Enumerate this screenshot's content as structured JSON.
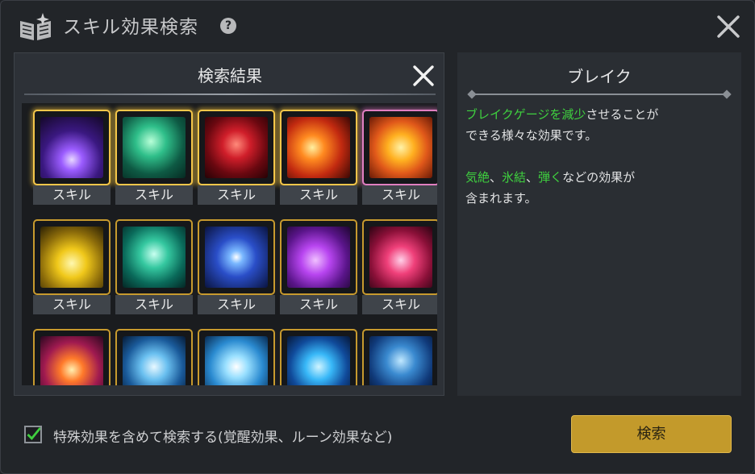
{
  "header": {
    "title": "スキル効果検索",
    "help": "?"
  },
  "results": {
    "title": "検索結果",
    "rows": [
      [
        {
          "label": "スキル",
          "art": "purple-lightning",
          "state": "selected"
        },
        {
          "label": "スキル",
          "art": "green-claw",
          "state": "selected"
        },
        {
          "label": "スキル",
          "art": "red-rune",
          "state": "selected"
        },
        {
          "label": "スキル",
          "art": "fire-meteor",
          "state": "selected"
        },
        {
          "label": "スキル",
          "art": "lava-burst",
          "state": "pink"
        }
      ],
      [
        {
          "label": "スキル",
          "art": "yellow-lightning",
          "state": "normal"
        },
        {
          "label": "スキル",
          "art": "green-storm",
          "state": "normal"
        },
        {
          "label": "スキル",
          "art": "blue-star",
          "state": "normal"
        },
        {
          "label": "スキル",
          "art": "purple-vortex",
          "state": "normal"
        },
        {
          "label": "スキル",
          "art": "pink-vortex",
          "state": "normal"
        }
      ],
      [
        {
          "label": "",
          "art": "orange-flare",
          "state": "normal"
        },
        {
          "label": "",
          "art": "ice-slash",
          "state": "normal"
        },
        {
          "label": "",
          "art": "frost-orb",
          "state": "normal"
        },
        {
          "label": "",
          "art": "blue-ring",
          "state": "normal"
        },
        {
          "label": "",
          "art": "ice-spikes",
          "state": "normal"
        }
      ]
    ]
  },
  "description": {
    "title": "ブレイク",
    "p1_hl": "ブレイクゲージを減少",
    "p1_rest": "させることが",
    "p1_line2": "できる様々な効果です。",
    "p2_hl1": "気絶",
    "p2_sep1": "、",
    "p2_hl2": "氷結",
    "p2_sep2": "、",
    "p2_hl3": "弾く",
    "p2_rest": "などの効果が",
    "p2_line2": "含まれます。"
  },
  "footer": {
    "checkbox_checked": true,
    "checkbox_label": "特殊効果を含めて検索する(覚醒効果、ルーン効果など)",
    "search_label": "検索"
  },
  "colors": {
    "accent_gold": "#c39a2b",
    "highlight_green": "#3fd13f",
    "panel": "#2d3137"
  }
}
